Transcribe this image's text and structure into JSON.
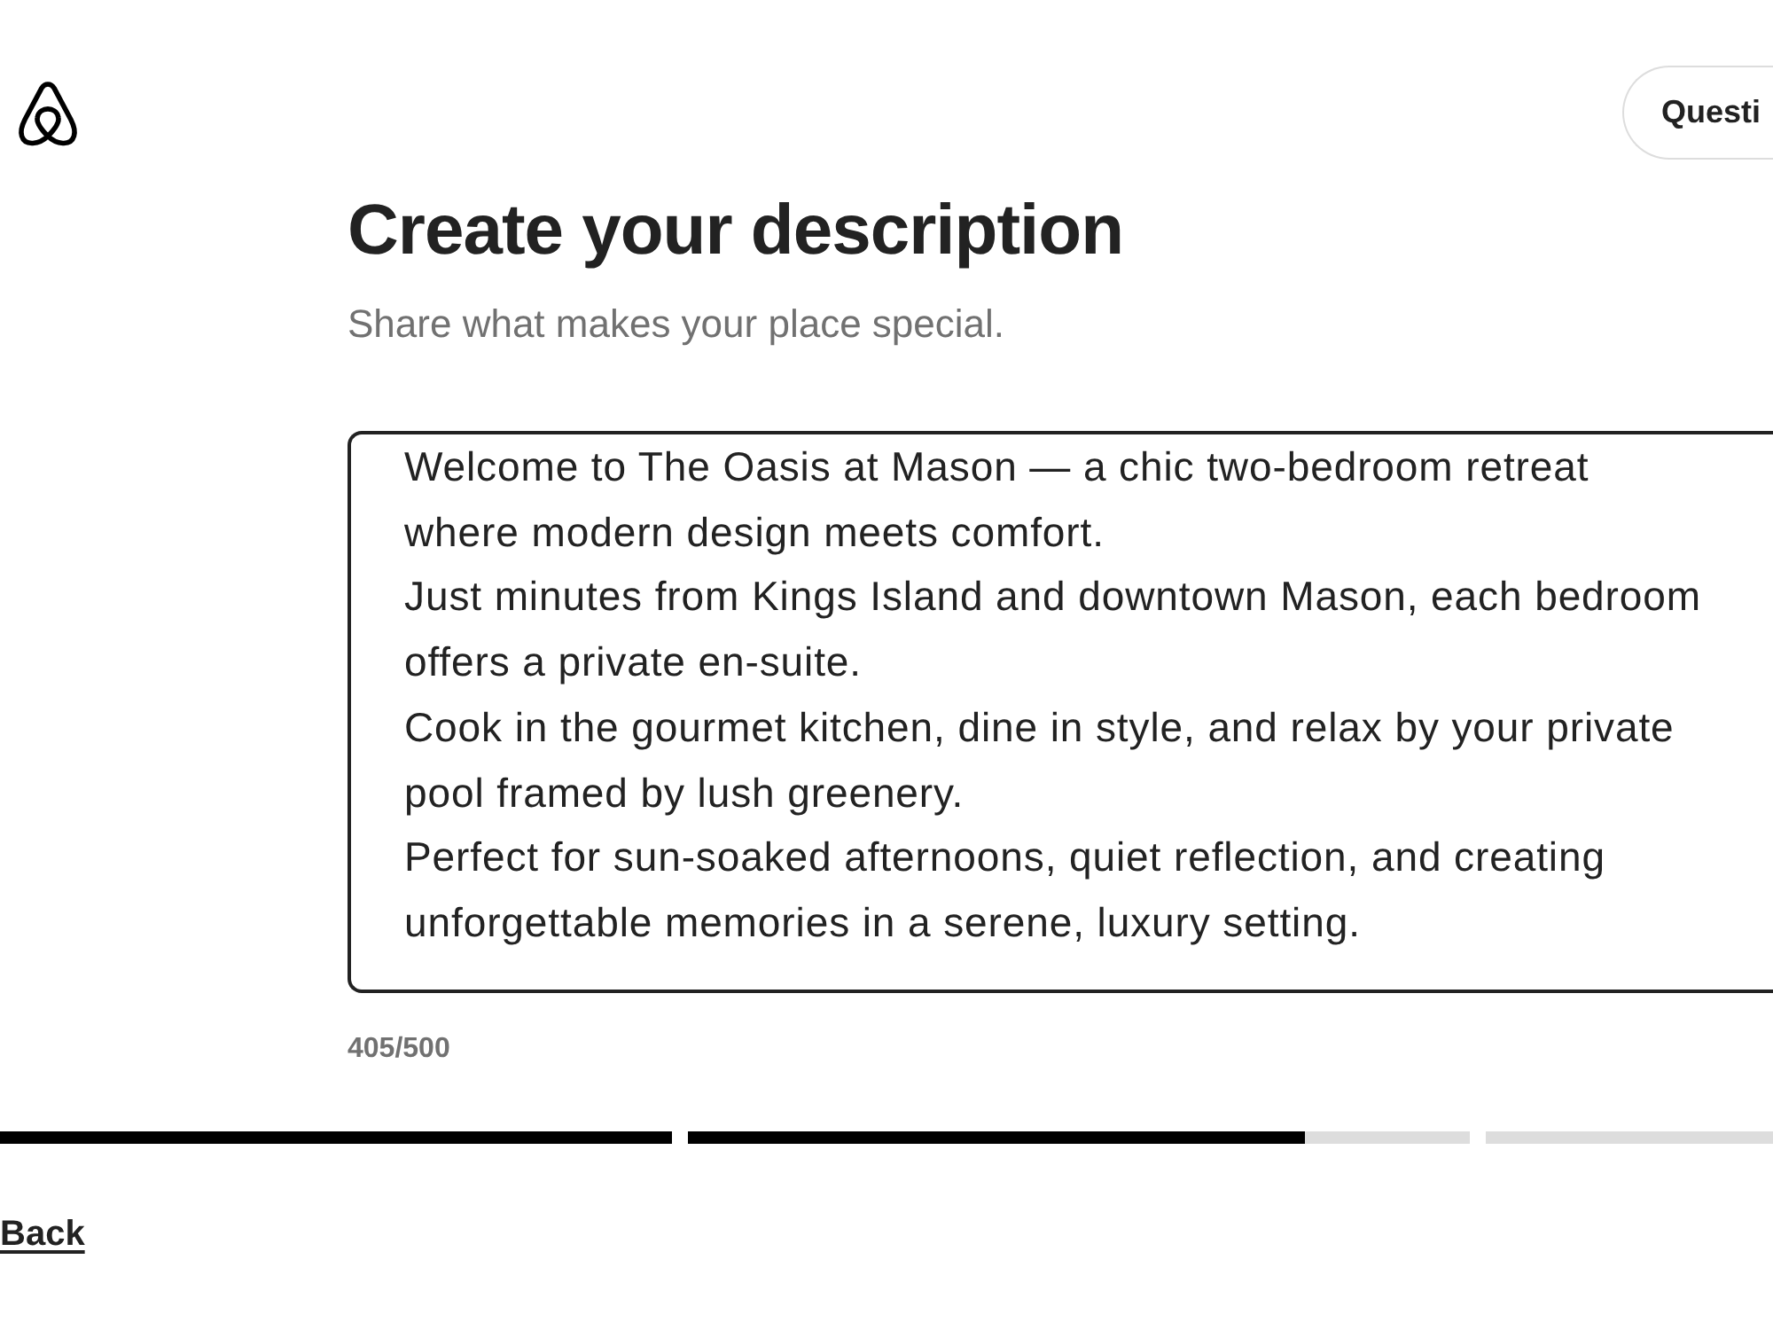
{
  "header": {
    "questions_button": {
      "label": "Questi"
    }
  },
  "page": {
    "title": "Create your description",
    "subtitle": "Share what makes your place special."
  },
  "description": {
    "value": "Welcome to The Oasis at Mason — a chic two-bedroom retreat where modern design meets comfort.\nJust minutes from Kings Island and downtown Mason, each bedroom offers a private en-suite.\nCook in the gourmet kitchen, dine in style, and relax by your private pool framed by lush greenery.\nPerfect for sun-soaked afternoons, quiet reflection, and creating unforgettable memories in a serene, luxury setting.",
    "counter": "405/500"
  },
  "progress": [
    {
      "kind": "done"
    },
    {
      "kind": "active",
      "level": 0.79
    },
    {
      "kind": "todo"
    }
  ],
  "footer": {
    "back_link": "Back"
  }
}
